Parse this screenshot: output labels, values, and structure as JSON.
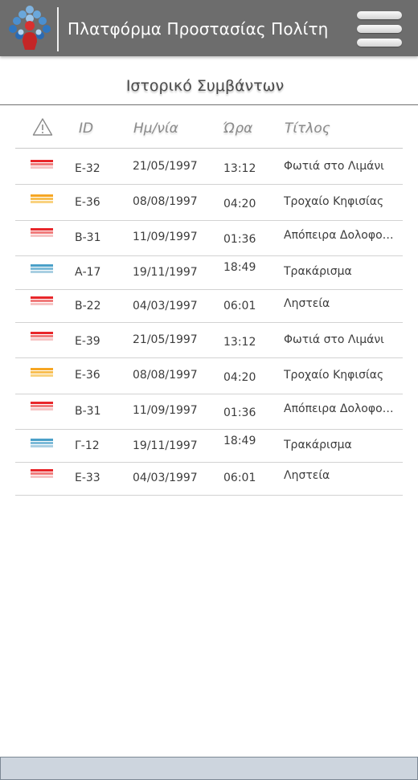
{
  "header": {
    "app_title": "Πλατφόρμα Προστασίας Πολίτη",
    "logo_icon": "people-tree-logo",
    "menu_icon": "hamburger-menu-icon"
  },
  "page": {
    "title": "Ιστορικό Συμβάντων"
  },
  "table": {
    "columns": {
      "alert": "alert-triangle-icon",
      "id": "ID",
      "date": "Ημ/νία",
      "time": "Ώρα",
      "title": "Τίτλος"
    },
    "severity_colors": {
      "high": [
        "#e8262a",
        "#f07b7b",
        "#f6c4c4"
      ],
      "medium": [
        "#f6a623",
        "#f8bf52",
        "#f9d27f"
      ],
      "low": [
        "#4aa0c8",
        "#7dbbd8",
        "#a9cfe2"
      ]
    },
    "rows": [
      {
        "severity": "high",
        "id": "Ε-32",
        "date": "21/05/1997",
        "time": "13:12",
        "title": "Φωτιά στο Λιμάνι"
      },
      {
        "severity": "medium",
        "id": "Ε-36",
        "date": "08/08/1997",
        "time": "04:20",
        "title": "Τροχαίο Κηφισίας"
      },
      {
        "severity": "high",
        "id": "Β-31",
        "date": "11/09/1997",
        "time": "01:36",
        "title": "Απόπειρα Δολοφονίας"
      },
      {
        "severity": "low",
        "id": "Α-17",
        "date": "19/11/1997",
        "time": "18:49",
        "title": "Τρακάρισμα"
      },
      {
        "severity": "high",
        "id": "Β-22",
        "date": "04/03/1997",
        "time": "06:01",
        "title": "Ληστεία"
      },
      {
        "severity": "high",
        "id": "Ε-39",
        "date": "21/05/1997",
        "time": "13:12",
        "title": "Φωτιά στο Λιμάνι"
      },
      {
        "severity": "medium",
        "id": "Ε-36",
        "date": "08/08/1997",
        "time": "04:20",
        "title": "Τροχαίο Κηφισίας"
      },
      {
        "severity": "high",
        "id": "Β-31",
        "date": "11/09/1997",
        "time": "01:36",
        "title": "Απόπειρα Δολοφονίας"
      },
      {
        "severity": "low",
        "id": "Γ-12",
        "date": "19/11/1997",
        "time": "18:49",
        "title": "Τρακάρισμα"
      },
      {
        "severity": "high",
        "id": "Ε-33",
        "date": "04/03/1997",
        "time": "06:01",
        "title": "Ληστεία"
      }
    ]
  }
}
